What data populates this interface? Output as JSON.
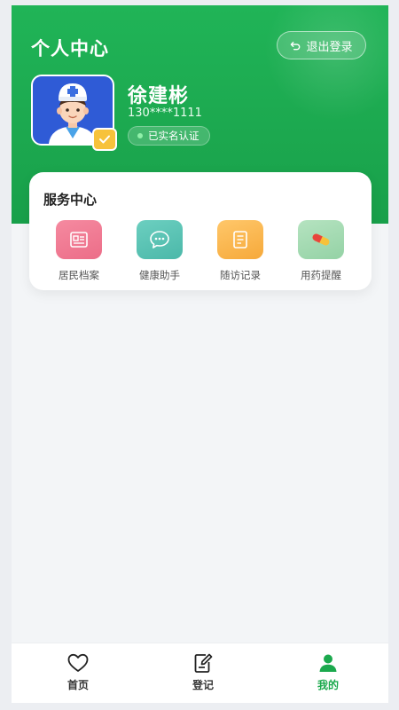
{
  "header": {
    "title": "个人中心",
    "logout_label": "退出登录"
  },
  "profile": {
    "name": "徐建彬",
    "phone": "130****1111",
    "verified_label": "已实名认证"
  },
  "services": {
    "title": "服务中心",
    "items": [
      {
        "label": "居民档案",
        "icon": "resident-file-icon",
        "color": "#f0758f"
      },
      {
        "label": "健康助手",
        "icon": "chat-bubble-icon",
        "color": "#55c3b4"
      },
      {
        "label": "随访记录",
        "icon": "document-icon",
        "color": "#f8b24a"
      },
      {
        "label": "用药提醒",
        "icon": "pill-icon",
        "color": "#a3dbb2"
      }
    ]
  },
  "tabbar": {
    "items": [
      {
        "label": "首页",
        "icon": "heart-icon"
      },
      {
        "label": "登记",
        "icon": "edit-document-icon"
      },
      {
        "label": "我的",
        "icon": "person-icon",
        "active": true
      }
    ]
  },
  "colors": {
    "brand_green": "#1ca84f",
    "badge_yellow": "#f7c23b",
    "avatar_blue": "#2f5bd6"
  }
}
